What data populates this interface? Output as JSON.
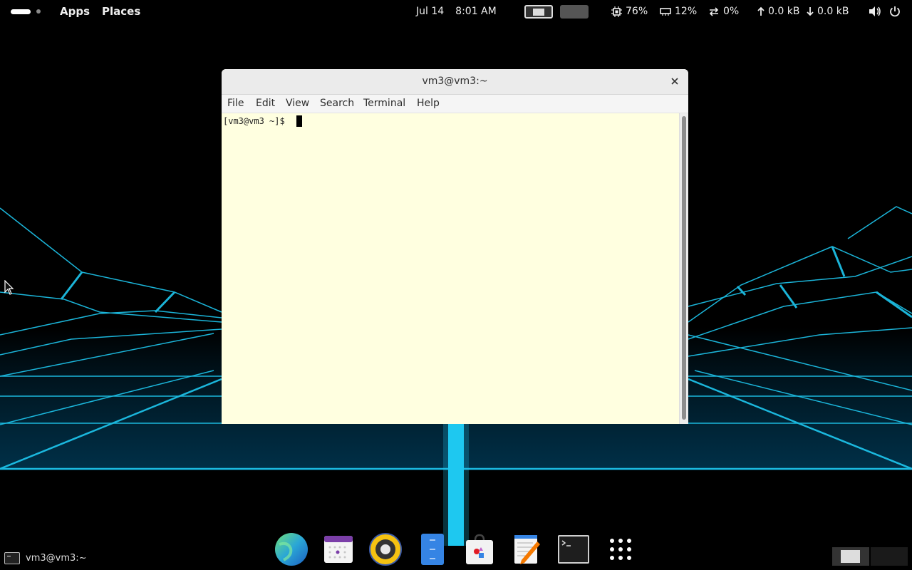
{
  "topbar": {
    "apps_label": "Apps",
    "places_label": "Places",
    "date": "Jul 14",
    "time": "8:01 AM",
    "cpu_label": "76%",
    "memory_label": "12%",
    "swap_label": "0%",
    "upload_label": "0.0 kB",
    "download_label": "0.0 kB",
    "workspaces_active": 1,
    "workspaces_count": 2
  },
  "terminal": {
    "title": "vm3@vm3:~",
    "menu": [
      "File",
      "Edit",
      "View",
      "Search",
      "Terminal",
      "Help"
    ],
    "prompt": "[vm3@vm3 ~]$ ",
    "background": "#ffffe0"
  },
  "dock": {
    "apps": [
      "globe-browser-icon",
      "calendar-icon",
      "speaker-icon",
      "file-manager-icon",
      "software-store-icon",
      "text-editor-icon",
      "terminal-icon",
      "app-grid-icon"
    ]
  },
  "tasklist": {
    "window_label": "vm3@vm3:~"
  },
  "colors": {
    "grid": "#1ec8f0",
    "panel": "#000000",
    "terminal_bg": "#ffffe0",
    "titlebar": "#ebebeb"
  }
}
